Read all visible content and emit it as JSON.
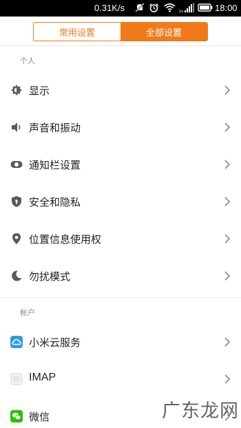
{
  "status_bar": {
    "network_speed": "0.31K/s",
    "time": "18:00",
    "icons": [
      "notification-off-icon",
      "alarm-icon",
      "wifi-icon",
      "signal-icon",
      "battery-icon"
    ]
  },
  "tabs": [
    {
      "label": "常用设置",
      "active": false
    },
    {
      "label": "全部设置",
      "active": true
    }
  ],
  "sections": {
    "personal": {
      "header": "个人",
      "items": [
        {
          "label": "显示",
          "icon": "brightness-icon"
        },
        {
          "label": "声音和振动",
          "icon": "speaker-icon"
        },
        {
          "label": "通知栏设置",
          "icon": "toggle-icon"
        },
        {
          "label": "安全和隐私",
          "icon": "shield-icon"
        },
        {
          "label": "位置信息使用权",
          "icon": "location-pin-icon"
        },
        {
          "label": "勿扰模式",
          "icon": "moon-icon"
        }
      ]
    },
    "accounts": {
      "header": "帐户",
      "items": [
        {
          "label": "小米云服务",
          "icon": "mi-cloud-icon"
        },
        {
          "label": "IMAP",
          "icon": "imap-icon"
        },
        {
          "label": "微信",
          "icon": "wechat-icon"
        }
      ]
    }
  },
  "watermark": "广东龙网",
  "colors": {
    "accent": "#f07a1a",
    "icon_gray": "#5a5a5a",
    "cloud_blue": "#2a9de0",
    "wechat_green": "#2dc100"
  }
}
